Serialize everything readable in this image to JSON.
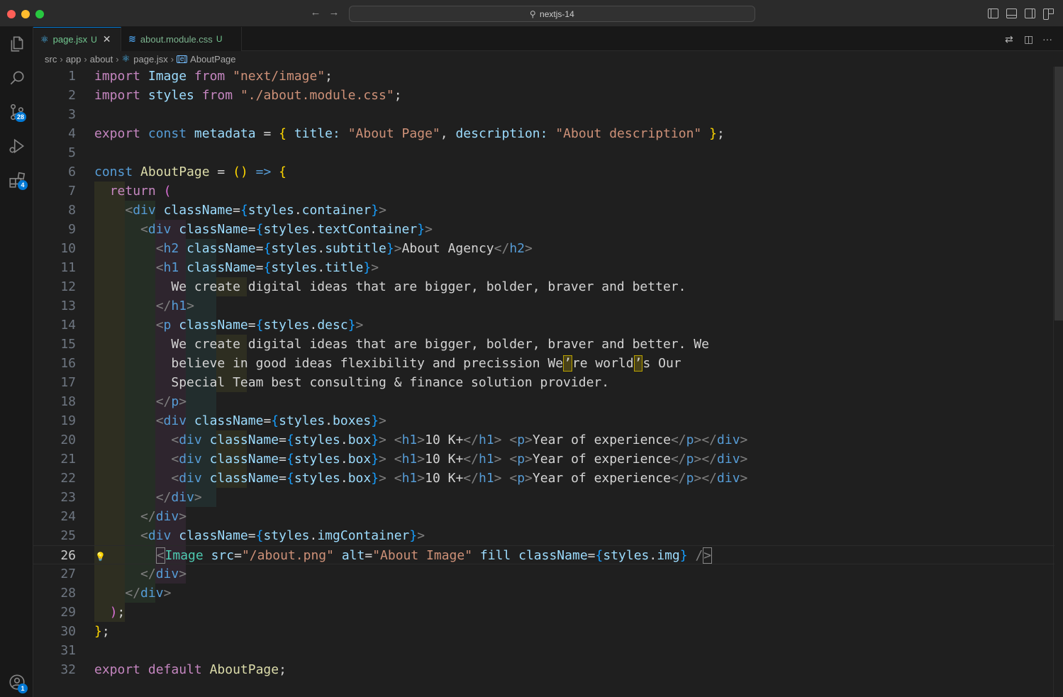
{
  "window": {
    "title": "nextjs-14"
  },
  "icons": {
    "explorer": "files-icon",
    "search": "search-icon",
    "source_control": "source-control-icon",
    "run_debug": "run-debug-icon",
    "extensions": "extensions-icon",
    "accounts": "account-icon"
  },
  "activity": {
    "source_control_badge": "28",
    "extensions_badge": "4",
    "accounts_badge": "1"
  },
  "tabs": [
    {
      "label": "page.jsx",
      "status": "U",
      "active": true
    },
    {
      "label": "about.module.css",
      "status": "U",
      "active": false
    }
  ],
  "tab_close": "✕",
  "breadcrumb": [
    "src",
    "app",
    "about",
    "page.jsx",
    "AboutPage"
  ],
  "editor": {
    "current_line": 26,
    "line_numbers": [
      "1",
      "2",
      "3",
      "4",
      "5",
      "6",
      "7",
      "8",
      "9",
      "10",
      "11",
      "12",
      "13",
      "14",
      "15",
      "16",
      "17",
      "18",
      "19",
      "20",
      "21",
      "22",
      "23",
      "24",
      "25",
      "26",
      "27",
      "28",
      "29",
      "30",
      "31",
      "32"
    ]
  },
  "colors": {
    "accent": "#0078d4",
    "modified_file": "#73c991",
    "keyword": "#569cd6",
    "control_keyword": "#c586c0",
    "string": "#ce9178",
    "variable": "#9cdcfe",
    "bracket_gold": "#ffd700"
  }
}
